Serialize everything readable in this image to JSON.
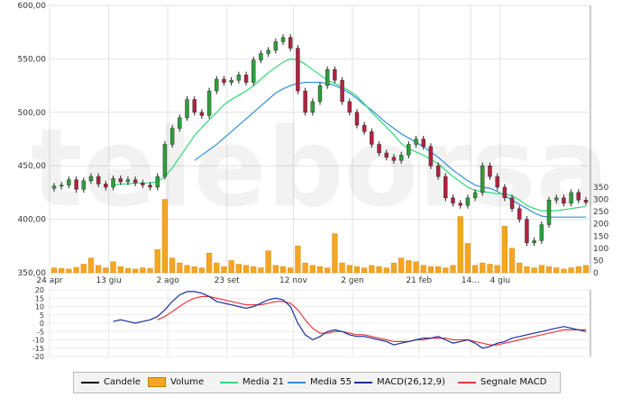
{
  "chart_data": [
    {
      "type": "candlestick",
      "title": "",
      "watermark": "teleborsa",
      "x_ticks": [
        "24 apr",
        "13 giu",
        "2 ago",
        "23 set",
        "12 nov",
        "2 gen",
        "21 feb",
        "14…",
        "4 giu"
      ],
      "y_ticks": [
        "600,00",
        "550,00",
        "500,00",
        "450,00",
        "400,00",
        "350,00"
      ],
      "ylim": [
        350,
        600
      ],
      "volume_ticks": [
        "350",
        "300",
        "250",
        "200",
        "150",
        "100",
        "50",
        "0"
      ],
      "volume_ylim": [
        0,
        350
      ],
      "grid": true,
      "candle_colors": {
        "up": "#2e9e3c",
        "down": "#b1233f"
      },
      "ma21_color": "#35d67a",
      "ma55_color": "#2f8fde",
      "volume_color": "#f4a623",
      "closes": [
        431,
        432,
        437,
        428,
        436,
        440,
        433,
        430,
        438,
        435,
        437,
        434,
        432,
        430,
        440,
        470,
        485,
        495,
        512,
        500,
        497,
        520,
        531,
        528,
        530,
        535,
        528,
        549,
        555,
        558,
        566,
        570,
        560,
        520,
        500,
        510,
        525,
        540,
        530,
        510,
        500,
        488,
        482,
        470,
        462,
        458,
        455,
        460,
        470,
        475,
        468,
        450,
        440,
        420,
        415,
        413,
        420,
        425,
        450,
        440,
        430,
        420,
        410,
        400,
        378,
        380,
        395,
        418,
        420,
        415,
        425,
        418,
        416
      ],
      "ma21": [
        null,
        null,
        null,
        null,
        null,
        null,
        null,
        null,
        432,
        433,
        433,
        434,
        434,
        434,
        435,
        440,
        448,
        458,
        468,
        478,
        486,
        493,
        500,
        507,
        512,
        516,
        520,
        525,
        531,
        537,
        542,
        547,
        550,
        549,
        545,
        540,
        535,
        530,
        527,
        524,
        520,
        515,
        508,
        500,
        493,
        486,
        479,
        471,
        466,
        463,
        460,
        456,
        452,
        446,
        440,
        435,
        430,
        427,
        426,
        425,
        424,
        424,
        422,
        418,
        413,
        410,
        408,
        408,
        408,
        409,
        410,
        411,
        412
      ],
      "ma55": [
        null,
        null,
        null,
        null,
        null,
        null,
        null,
        null,
        null,
        null,
        null,
        null,
        null,
        null,
        null,
        null,
        null,
        null,
        null,
        455,
        460,
        465,
        470,
        476,
        482,
        488,
        494,
        500,
        506,
        512,
        518,
        522,
        525,
        527,
        528,
        528,
        528,
        527,
        525,
        522,
        518,
        513,
        507,
        502,
        496,
        490,
        485,
        480,
        476,
        472,
        468,
        463,
        458,
        452,
        446,
        441,
        436,
        432,
        430,
        429,
        426,
        422,
        418,
        414,
        410,
        406,
        403,
        402,
        402,
        402,
        402,
        402,
        402
      ],
      "volumes": [
        20,
        18,
        15,
        22,
        35,
        60,
        30,
        20,
        45,
        25,
        18,
        15,
        20,
        18,
        95,
        300,
        60,
        40,
        30,
        25,
        20,
        80,
        40,
        25,
        50,
        35,
        30,
        25,
        20,
        90,
        30,
        25,
        20,
        110,
        40,
        30,
        25,
        20,
        160,
        40,
        30,
        25,
        20,
        30,
        25,
        20,
        40,
        60,
        50,
        45,
        30,
        25,
        25,
        20,
        30,
        230,
        120,
        30,
        40,
        35,
        30,
        190,
        100,
        40,
        25,
        20,
        30,
        25,
        20,
        15,
        20,
        25,
        30
      ]
    },
    {
      "type": "line",
      "title": "",
      "y_ticks": [
        "20",
        "15",
        "10",
        "5",
        "0",
        "-5",
        "-10",
        "-15",
        "-20"
      ],
      "ylim": [
        -20,
        20
      ],
      "series": [
        {
          "name": "MACD(26,12,9)",
          "color": "#1b2f9e",
          "values": [
            null,
            null,
            null,
            null,
            null,
            null,
            null,
            null,
            1,
            2,
            1,
            0,
            1,
            2,
            4,
            8,
            13,
            17,
            19,
            19,
            18,
            16,
            13,
            12,
            11,
            10,
            9,
            10,
            12,
            14,
            15,
            14,
            10,
            0,
            -7,
            -10,
            -8,
            -5,
            -4,
            -5,
            -7,
            -8,
            -8,
            -9,
            -10,
            -11,
            -13,
            -12,
            -11,
            -10,
            -9,
            -9,
            -8,
            -10,
            -12,
            -11,
            -10,
            -12,
            -15,
            -14,
            -12,
            -11,
            -9,
            -8,
            -7,
            -6,
            -5,
            -4,
            -3,
            -2,
            -3,
            -4,
            -5
          ]
        },
        {
          "name": "Segnale MACD",
          "color": "#e8383d",
          "values": [
            null,
            null,
            null,
            null,
            null,
            null,
            null,
            null,
            null,
            null,
            null,
            null,
            null,
            null,
            2,
            4,
            7,
            10,
            13,
            15,
            16,
            16,
            15,
            14,
            13,
            12,
            11,
            11,
            11,
            12,
            13,
            13,
            12,
            8,
            2,
            -3,
            -6,
            -6,
            -5,
            -5,
            -6,
            -7,
            -7,
            -8,
            -9,
            -10,
            -11,
            -11,
            -11,
            -10,
            -10,
            -9,
            -9,
            -9,
            -10,
            -10,
            -10,
            -11,
            -12,
            -13,
            -13,
            -12,
            -11,
            -10,
            -9,
            -8,
            -7,
            -6,
            -5,
            -4,
            -4,
            -4,
            -4
          ]
        }
      ]
    }
  ],
  "legend": [
    {
      "key": "candele",
      "label": "Candele",
      "kind": "line",
      "color": "#000000"
    },
    {
      "key": "volume",
      "label": "Volume",
      "kind": "box",
      "color": "#f4a623"
    },
    {
      "key": "media21",
      "label": "Media 21",
      "kind": "line",
      "color": "#35d67a"
    },
    {
      "key": "media55",
      "label": "Media 55",
      "kind": "line",
      "color": "#2f8fde"
    },
    {
      "key": "macd",
      "label": "MACD(26,12,9)",
      "kind": "line",
      "color": "#1b2f9e"
    },
    {
      "key": "signal",
      "label": "Segnale MACD",
      "kind": "line",
      "color": "#e8383d"
    }
  ]
}
